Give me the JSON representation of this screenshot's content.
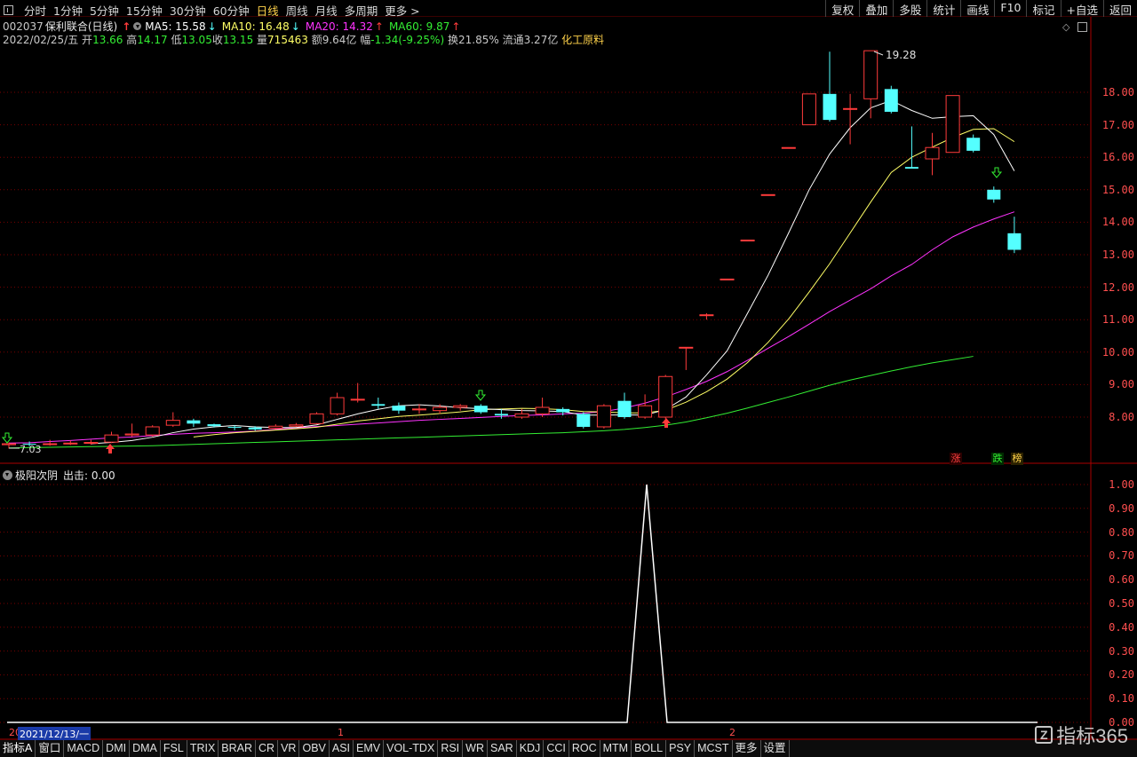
{
  "toolbar": {
    "timeframes": [
      "分时",
      "1分钟",
      "5分钟",
      "15分钟",
      "30分钟",
      "60分钟",
      "日线",
      "周线",
      "月线",
      "多周期",
      "更多 >"
    ],
    "active_timeframe": "日线",
    "right_buttons": [
      "复权",
      "叠加",
      "多股",
      "统计",
      "画线",
      "F10",
      "标记",
      "+自选",
      "返回"
    ]
  },
  "stock": {
    "code": "002037",
    "name": "保利联合(日线)",
    "ma5_label": "MA5: 15.58",
    "ma10_label": "MA10: 16.48",
    "ma20_label": "MA20: 14.32",
    "ma60_label": "MA60: 9.87"
  },
  "quote": {
    "date": "2022/02/25/五",
    "open_label": "开",
    "open": "13.66",
    "high_label": "高",
    "high": "14.17",
    "low_label": "低",
    "low": "13.05",
    "close_label": "收",
    "close": "13.15",
    "vol_label": "量",
    "vol": "715463",
    "amount_label": "额",
    "amount": "9.64亿",
    "change_label": "幅",
    "change": "-1.34(-9.25%)",
    "turnover_label": "换",
    "turnover": "21.85%",
    "float_label": "流通",
    "float": "3.27亿",
    "sector": "化工原料"
  },
  "colors": {
    "up": "#ff3b3b",
    "down": "#54ffff",
    "ma5": "#ffffff",
    "ma10": "#ffff66",
    "ma20": "#ff33ff",
    "ma60": "#33ee33",
    "grid": "#7a0000",
    "scale_text": "#ff4f4f"
  },
  "price_axis": {
    "labels": [
      "18.00",
      "17.00",
      "16.00",
      "15.00",
      "14.00",
      "13.00",
      "12.00",
      "11.00",
      "10.00",
      "9.00",
      "8.00"
    ],
    "min": 7.0,
    "max": 19.5
  },
  "annotations": {
    "high_marker": "19.28",
    "low_marker": "7.03",
    "badges": [
      "涨",
      "跌",
      "榜"
    ]
  },
  "chart_data": {
    "type": "candlestick",
    "candles": [
      {
        "o": 7.15,
        "c": 7.18,
        "h": 7.22,
        "l": 7.03
      },
      {
        "o": 7.18,
        "c": 7.16,
        "h": 7.25,
        "l": 7.1
      },
      {
        "o": 7.16,
        "c": 7.18,
        "h": 7.3,
        "l": 7.12
      },
      {
        "o": 7.18,
        "c": 7.2,
        "h": 7.28,
        "l": 7.14
      },
      {
        "o": 7.2,
        "c": 7.22,
        "h": 7.3,
        "l": 7.15
      },
      {
        "o": 7.23,
        "c": 7.45,
        "h": 7.55,
        "l": 7.2
      },
      {
        "o": 7.45,
        "c": 7.48,
        "h": 7.8,
        "l": 7.4
      },
      {
        "o": 7.45,
        "c": 7.7,
        "h": 7.75,
        "l": 7.4
      },
      {
        "o": 7.75,
        "c": 7.9,
        "h": 8.15,
        "l": 7.7
      },
      {
        "o": 7.9,
        "c": 7.8,
        "h": 7.95,
        "l": 7.7
      },
      {
        "o": 7.78,
        "c": 7.72,
        "h": 7.8,
        "l": 7.68
      },
      {
        "o": 7.7,
        "c": 7.68,
        "h": 7.75,
        "l": 7.6
      },
      {
        "o": 7.68,
        "c": 7.62,
        "h": 7.72,
        "l": 7.58
      },
      {
        "o": 7.66,
        "c": 7.72,
        "h": 7.78,
        "l": 7.62
      },
      {
        "o": 7.72,
        "c": 7.76,
        "h": 7.82,
        "l": 7.7
      },
      {
        "o": 7.8,
        "c": 8.1,
        "h": 8.15,
        "l": 7.78
      },
      {
        "o": 8.1,
        "c": 8.6,
        "h": 8.75,
        "l": 8.05
      },
      {
        "o": 8.55,
        "c": 8.55,
        "h": 9.05,
        "l": 8.45
      },
      {
        "o": 8.4,
        "c": 8.35,
        "h": 8.6,
        "l": 8.25
      },
      {
        "o": 8.35,
        "c": 8.2,
        "h": 8.45,
        "l": 8.1
      },
      {
        "o": 8.25,
        "c": 8.25,
        "h": 8.4,
        "l": 8.1
      },
      {
        "o": 8.2,
        "c": 8.3,
        "h": 8.4,
        "l": 8.1
      },
      {
        "o": 8.3,
        "c": 8.35,
        "h": 8.4,
        "l": 8.2
      },
      {
        "o": 8.35,
        "c": 8.15,
        "h": 8.4,
        "l": 8.1
      },
      {
        "o": 8.1,
        "c": 8.05,
        "h": 8.25,
        "l": 7.95
      },
      {
        "o": 8.0,
        "c": 8.1,
        "h": 8.25,
        "l": 7.95
      },
      {
        "o": 8.1,
        "c": 8.3,
        "h": 8.6,
        "l": 8.0
      },
      {
        "o": 8.25,
        "c": 8.15,
        "h": 8.3,
        "l": 8.05
      },
      {
        "o": 8.1,
        "c": 7.7,
        "h": 8.15,
        "l": 7.65
      },
      {
        "o": 7.7,
        "c": 8.35,
        "h": 8.4,
        "l": 7.65
      },
      {
        "o": 8.5,
        "c": 8.0,
        "h": 8.75,
        "l": 7.95
      },
      {
        "o": 8.0,
        "c": 8.35,
        "h": 8.7,
        "l": 7.95
      },
      {
        "o": 8.0,
        "c": 9.25,
        "h": 9.3,
        "l": 7.95
      },
      {
        "o": 10.15,
        "c": 10.15,
        "h": 10.15,
        "l": 9.45
      },
      {
        "o": 11.15,
        "c": 11.15,
        "h": 11.2,
        "l": 11.0
      },
      {
        "o": 12.25,
        "c": 12.25,
        "h": 12.25,
        "l": 12.25
      },
      {
        "o": 13.45,
        "c": 13.45,
        "h": 13.45,
        "l": 13.45
      },
      {
        "o": 14.85,
        "c": 14.85,
        "h": 14.85,
        "l": 14.85
      },
      {
        "o": 16.3,
        "c": 16.3,
        "h": 16.3,
        "l": 16.3
      },
      {
        "o": 17.0,
        "c": 17.95,
        "h": 17.95,
        "l": 17.0
      },
      {
        "o": 17.95,
        "c": 17.15,
        "h": 19.25,
        "l": 17.1
      },
      {
        "o": 17.5,
        "c": 17.5,
        "h": 17.95,
        "l": 16.4
      },
      {
        "o": 17.8,
        "c": 19.28,
        "h": 19.28,
        "l": 17.2
      },
      {
        "o": 18.1,
        "c": 17.4,
        "h": 18.2,
        "l": 17.35
      },
      {
        "o": 15.7,
        "c": 15.65,
        "h": 16.95,
        "l": 15.65
      },
      {
        "o": 15.95,
        "c": 16.3,
        "h": 16.75,
        "l": 15.45
      },
      {
        "o": 16.15,
        "c": 17.9,
        "h": 17.9,
        "l": 16.15
      },
      {
        "o": 16.6,
        "c": 16.2,
        "h": 16.7,
        "l": 16.15
      },
      {
        "o": 15.0,
        "c": 14.7,
        "h": 15.1,
        "l": 14.6
      },
      {
        "o": 13.66,
        "c": 13.15,
        "h": 14.17,
        "l": 13.05
      }
    ],
    "ma5": [
      null,
      null,
      null,
      null,
      7.18,
      7.22,
      7.28,
      7.38,
      7.52,
      7.63,
      7.7,
      7.74,
      7.7,
      7.68,
      7.68,
      7.76,
      7.93,
      8.1,
      8.24,
      8.35,
      8.38,
      8.34,
      8.29,
      8.26,
      8.23,
      8.2,
      8.19,
      8.17,
      8.06,
      8.06,
      8.07,
      8.06,
      8.23,
      8.62,
      9.3,
      10.04,
      11.2,
      12.37,
      13.67,
      15.0,
      16.1,
      16.91,
      17.52,
      17.75,
      17.44,
      17.2,
      17.25,
      17.28,
      16.7,
      15.58
    ],
    "ma10": [
      null,
      null,
      null,
      null,
      null,
      null,
      null,
      null,
      null,
      7.39,
      7.46,
      7.52,
      7.56,
      7.6,
      7.64,
      7.69,
      7.78,
      7.88,
      7.95,
      8.02,
      8.06,
      8.11,
      8.16,
      8.23,
      8.25,
      8.27,
      8.26,
      8.23,
      8.17,
      8.16,
      8.13,
      8.13,
      8.21,
      8.46,
      8.78,
      9.17,
      9.68,
      10.3,
      11.02,
      11.85,
      12.72,
      13.67,
      14.62,
      15.53,
      16.0,
      16.31,
      16.61,
      16.86,
      16.88,
      16.48
    ],
    "ma20": [
      7.18,
      7.18,
      7.19,
      7.2,
      7.21,
      7.25,
      7.28,
      7.32,
      7.36,
      7.39,
      7.43,
      7.47,
      7.5,
      7.52,
      7.54,
      7.57,
      7.62,
      7.67,
      7.71,
      7.74,
      7.78,
      7.82,
      7.86,
      7.9,
      7.93,
      7.96,
      7.99,
      8.02,
      8.05,
      8.07,
      8.1,
      8.12,
      8.17,
      8.28,
      8.43,
      8.62,
      8.85,
      9.1,
      9.4,
      9.75,
      10.12,
      10.48,
      10.86,
      11.25,
      11.6,
      11.95,
      12.35,
      12.7,
      13.15,
      13.55,
      13.85,
      14.1,
      14.32
    ],
    "ma60": [
      7.05,
      7.06,
      7.07,
      7.08,
      7.09,
      7.1,
      7.11,
      7.12,
      7.14,
      7.16,
      7.18,
      7.2,
      7.22,
      7.24,
      7.26,
      7.28,
      7.3,
      7.32,
      7.34,
      7.36,
      7.38,
      7.4,
      7.42,
      7.44,
      7.46,
      7.48,
      7.5,
      7.52,
      7.55,
      7.58,
      7.62,
      7.68,
      7.75,
      7.85,
      7.98,
      8.12,
      8.28,
      8.45,
      8.62,
      8.8,
      8.98,
      9.14,
      9.28,
      9.42,
      9.55,
      9.67,
      9.77,
      9.87
    ]
  },
  "sub_chart": {
    "indicator_name": "极阳次阴",
    "output_label": "出击: 0.00",
    "axis_labels": [
      "1.00",
      "0.90",
      "0.80",
      "0.70",
      "0.60",
      "0.50",
      "0.40",
      "0.30",
      "0.20",
      "0.10",
      "0.00"
    ],
    "signal_value": 1.0
  },
  "date_bar": {
    "selected_date": "2021/12/13/一",
    "month_marks": [
      "20",
      "1",
      "2"
    ]
  },
  "bottom_tabs": [
    "指标A",
    "窗口",
    "MACD",
    "DMI",
    "DMA",
    "FSL",
    "TRIX",
    "BRAR",
    "CR",
    "VR",
    "OBV",
    "ASI",
    "EMV",
    "VOL-TDX",
    "RSI",
    "WR",
    "SAR",
    "KDJ",
    "CCI",
    "ROC",
    "MTM",
    "BOLL",
    "PSY",
    "MCST",
    "更多",
    "设置"
  ],
  "watermark": {
    "logo": "Z",
    "text": "指标365"
  }
}
